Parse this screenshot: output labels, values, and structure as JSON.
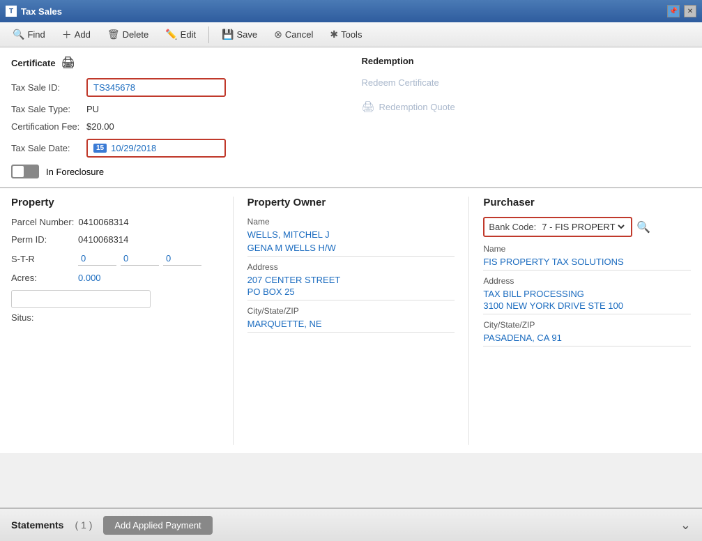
{
  "titleBar": {
    "title": "Tax Sales",
    "pinLabel": "📌",
    "closeLabel": "✕"
  },
  "toolbar": {
    "find": "Find",
    "add": "Add",
    "delete": "Delete",
    "edit": "Edit",
    "save": "Save",
    "cancel": "Cancel",
    "tools": "Tools"
  },
  "certificate": {
    "heading": "Certificate",
    "taxSaleIdLabel": "Tax Sale ID:",
    "taxSaleIdValue": "TS345678",
    "taxSaleTypeLabel": "Tax Sale Type:",
    "taxSaleTypeValue": "PU",
    "certFeeLabel": "Certification Fee:",
    "certFeeValue": "$20.00",
    "taxSaleDateLabel": "Tax Sale Date:",
    "taxSaleDateDay": "15",
    "taxSaleDateValue": "10/29/2018",
    "inForeclosureLabel": "In Foreclosure"
  },
  "redemption": {
    "heading": "Redemption",
    "redeemCertLabel": "Redeem Certificate",
    "redemptionQuoteLabel": "Redemption Quote"
  },
  "property": {
    "heading": "Property",
    "parcelLabel": "Parcel Number:",
    "parcelValue": "0410068314",
    "permIdLabel": "Perm ID:",
    "permIdValue": "0410068314",
    "strLabel": "S-T-R",
    "strS": "0",
    "strT": "0",
    "strR": "0",
    "acresLabel": "Acres:",
    "acresValue": "0.000",
    "situsLabel": "Situs:"
  },
  "propertyOwner": {
    "heading": "Property Owner",
    "nameLabel": "Name",
    "name1": "WELLS, MITCHEL J",
    "name2": "GENA M WELLS H/W",
    "addressLabel": "Address",
    "addr1": "207 CENTER STREET",
    "addr2": "PO BOX 25",
    "cityStateZipLabel": "City/State/ZIP",
    "cityStateZip": "MARQUETTE, NE"
  },
  "purchaser": {
    "heading": "Purchaser",
    "bankCodeLabel": "Bank Code:",
    "bankCodeValue": "7 - FIS PROPERT",
    "nameLabel": "Name",
    "nameValue": "FIS PROPERTY TAX SOLUTIONS",
    "addressLabel": "Address",
    "addr1": "TAX BILL PROCESSING",
    "addr2": "3100 NEW YORK DRIVE STE 100",
    "cityStateZipLabel": "City/State/ZIP",
    "cityStateZip": "PASADENA, CA 91"
  },
  "footer": {
    "statementsLabel": "Statements",
    "statementsCount": "( 1 )",
    "addPaymentLabel": "Add Applied Payment"
  }
}
